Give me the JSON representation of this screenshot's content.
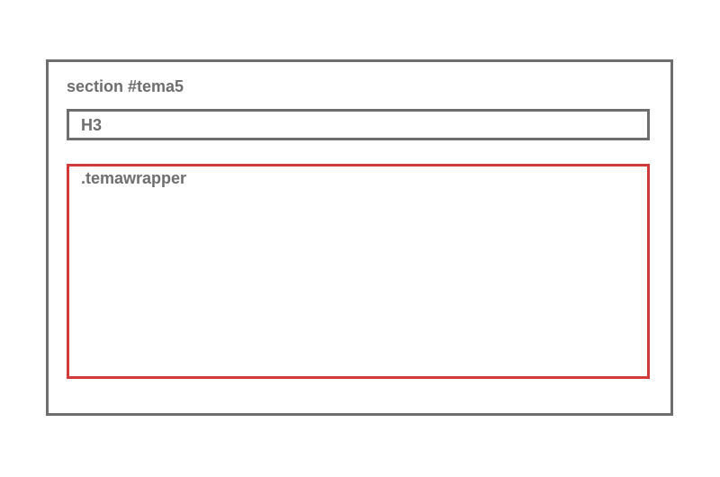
{
  "diagram": {
    "section": {
      "label": "section #tema5",
      "border_color": "#6e6e6e"
    },
    "heading_block": {
      "label": "H3",
      "border_color": "#6e6e6e"
    },
    "wrapper_block": {
      "label": ".temawrapper",
      "border_color": "#d23a3a"
    }
  }
}
